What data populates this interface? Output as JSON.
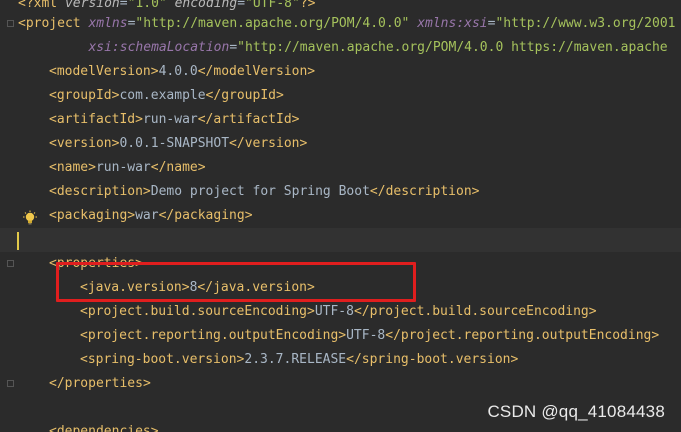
{
  "editor": {
    "lines": [
      {
        "id": "l0",
        "parts": [
          [
            "pi",
            "<?xml "
          ],
          [
            "pi-attr",
            "version"
          ],
          [
            "text",
            "="
          ],
          [
            "val",
            "\"1.0\" "
          ],
          [
            "pi-attr",
            "encoding"
          ],
          [
            "text",
            "="
          ],
          [
            "val",
            "\"UTF-8\""
          ],
          [
            "pi",
            "?>"
          ]
        ]
      },
      {
        "id": "l1",
        "parts": [
          [
            "bracket",
            "<"
          ],
          [
            "tag",
            "project "
          ],
          [
            "attr-ns",
            "xmlns"
          ],
          [
            "text",
            "="
          ],
          [
            "val",
            "\"http://maven.apache.org/POM/4.0.0\" "
          ],
          [
            "attr-ns",
            "xmlns:xsi"
          ],
          [
            "text",
            "="
          ],
          [
            "val",
            "\"http://www.w3.org/2001"
          ]
        ]
      },
      {
        "id": "l2",
        "parts": [
          [
            "text",
            "         "
          ],
          [
            "attr-ns",
            "xsi:schemaLocation"
          ],
          [
            "text",
            "="
          ],
          [
            "val",
            "\"http://maven.apache.org/POM/4.0.0 https://maven.apache"
          ]
        ]
      },
      {
        "id": "l3",
        "parts": [
          [
            "bracket",
            "<"
          ],
          [
            "tag",
            "modelVersion"
          ],
          [
            "bracket",
            ">"
          ],
          [
            "text",
            "4.0.0"
          ],
          [
            "bracket",
            "</"
          ],
          [
            "tag",
            "modelVersion"
          ],
          [
            "bracket",
            ">"
          ]
        ]
      },
      {
        "id": "l4",
        "parts": [
          [
            "bracket",
            "<"
          ],
          [
            "tag",
            "groupId"
          ],
          [
            "bracket",
            ">"
          ],
          [
            "text",
            "com.example"
          ],
          [
            "bracket",
            "</"
          ],
          [
            "tag",
            "groupId"
          ],
          [
            "bracket",
            ">"
          ]
        ]
      },
      {
        "id": "l5",
        "parts": [
          [
            "bracket",
            "<"
          ],
          [
            "tag",
            "artifactId"
          ],
          [
            "bracket",
            ">"
          ],
          [
            "text",
            "run-war"
          ],
          [
            "bracket",
            "</"
          ],
          [
            "tag",
            "artifactId"
          ],
          [
            "bracket",
            ">"
          ]
        ]
      },
      {
        "id": "l6",
        "parts": [
          [
            "bracket",
            "<"
          ],
          [
            "tag",
            "version"
          ],
          [
            "bracket",
            ">"
          ],
          [
            "text",
            "0.0.1-SNAPSHOT"
          ],
          [
            "bracket",
            "</"
          ],
          [
            "tag",
            "version"
          ],
          [
            "bracket",
            ">"
          ]
        ]
      },
      {
        "id": "l7",
        "parts": [
          [
            "bracket",
            "<"
          ],
          [
            "tag",
            "name"
          ],
          [
            "bracket",
            ">"
          ],
          [
            "text",
            "run-war"
          ],
          [
            "bracket",
            "</"
          ],
          [
            "tag",
            "name"
          ],
          [
            "bracket",
            ">"
          ]
        ]
      },
      {
        "id": "l8",
        "parts": [
          [
            "bracket",
            "<"
          ],
          [
            "tag",
            "description"
          ],
          [
            "bracket",
            ">"
          ],
          [
            "text",
            "Demo project for Spring Boot"
          ],
          [
            "bracket",
            "</"
          ],
          [
            "tag",
            "description"
          ],
          [
            "bracket",
            ">"
          ]
        ]
      },
      {
        "id": "l9",
        "parts": [
          [
            "bracket",
            "<"
          ],
          [
            "tag",
            "packaging"
          ],
          [
            "bracket",
            ">"
          ],
          [
            "text",
            "war"
          ],
          [
            "bracket",
            "</"
          ],
          [
            "tag",
            "packaging"
          ],
          [
            "bracket",
            ">"
          ]
        ]
      },
      {
        "id": "l10",
        "parts": []
      },
      {
        "id": "l11",
        "parts": [
          [
            "bracket",
            "<"
          ],
          [
            "tag",
            "properties"
          ],
          [
            "bracket",
            ">"
          ]
        ]
      },
      {
        "id": "l12",
        "parts": [
          [
            "bracket",
            "<"
          ],
          [
            "tag",
            "java.version"
          ],
          [
            "bracket",
            ">"
          ],
          [
            "text",
            "8"
          ],
          [
            "bracket",
            "</"
          ],
          [
            "tag",
            "java.version"
          ],
          [
            "bracket",
            ">"
          ]
        ]
      },
      {
        "id": "l13",
        "parts": [
          [
            "bracket",
            "<"
          ],
          [
            "tag",
            "project.build.sourceEncoding"
          ],
          [
            "bracket",
            ">"
          ],
          [
            "text",
            "UTF-8"
          ],
          [
            "bracket",
            "</"
          ],
          [
            "tag",
            "project.build.sourceEncoding"
          ],
          [
            "bracket",
            ">"
          ]
        ]
      },
      {
        "id": "l14",
        "parts": [
          [
            "bracket",
            "<"
          ],
          [
            "tag",
            "project.reporting.outputEncoding"
          ],
          [
            "bracket",
            ">"
          ],
          [
            "text",
            "UTF-8"
          ],
          [
            "bracket",
            "</"
          ],
          [
            "tag",
            "project.reporting.outputEncoding"
          ],
          [
            "bracket",
            ">"
          ]
        ]
      },
      {
        "id": "l15",
        "parts": [
          [
            "bracket",
            "<"
          ],
          [
            "tag",
            "spring-boot.version"
          ],
          [
            "bracket",
            ">"
          ],
          [
            "text",
            "2.3.7.RELEASE"
          ],
          [
            "bracket",
            "</"
          ],
          [
            "tag",
            "spring-boot.version"
          ],
          [
            "bracket",
            ">"
          ]
        ]
      },
      {
        "id": "l16",
        "parts": [
          [
            "bracket",
            "</"
          ],
          [
            "tag",
            "properties"
          ],
          [
            "bracket",
            ">"
          ]
        ]
      },
      {
        "id": "l17",
        "parts": []
      },
      {
        "id": "l18",
        "parts": [
          [
            "bracket",
            "<"
          ],
          [
            "tag",
            "dependencies"
          ],
          [
            "bracket",
            ">"
          ]
        ]
      }
    ]
  },
  "watermark": "CSDN @qq_41084438",
  "colors": {
    "background": "#2b2b2b",
    "current_line": "#323232",
    "tag": "#e8bf6a",
    "value": "#a5c25c",
    "text": "#a9b7c6",
    "namespace_attr": "#9876aa",
    "highlight_box": "#e01e1e",
    "caret": "#e2c94a"
  },
  "icons": {
    "intention": "lightbulb-icon"
  }
}
